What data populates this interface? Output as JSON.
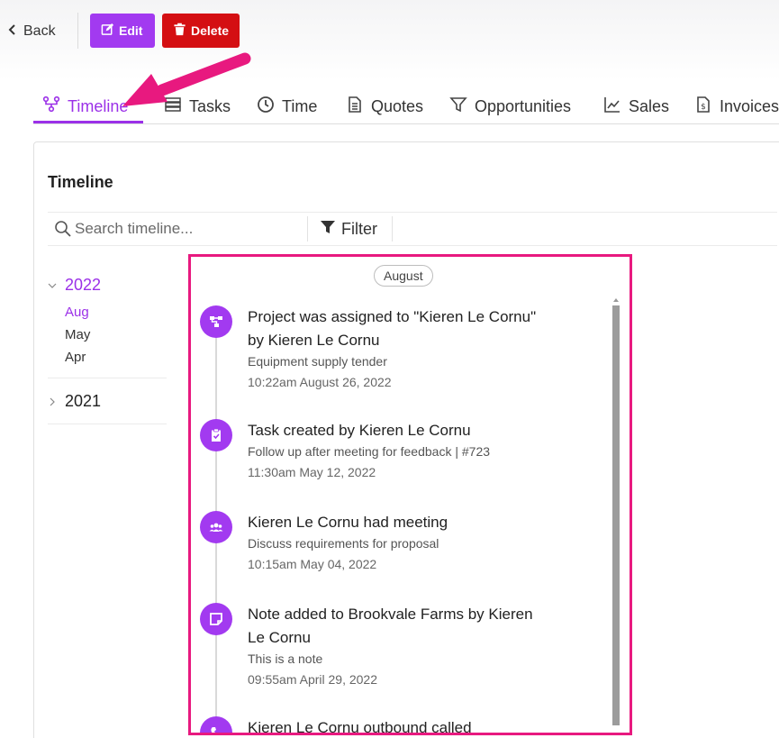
{
  "toolbar": {
    "back_label": "Back",
    "edit_label": "Edit",
    "delete_label": "Delete"
  },
  "tabs": [
    {
      "label": "Timeline",
      "icon": "timeline-icon",
      "active": true
    },
    {
      "label": "Tasks",
      "icon": "tasks-icon"
    },
    {
      "label": "Time",
      "icon": "clock-icon"
    },
    {
      "label": "Quotes",
      "icon": "document-icon"
    },
    {
      "label": "Opportunities",
      "icon": "funnel-icon"
    },
    {
      "label": "Sales",
      "icon": "line-chart-icon"
    },
    {
      "label": "Invoices",
      "icon": "invoice-icon"
    }
  ],
  "panel": {
    "title": "Timeline",
    "search_placeholder": "Search timeline...",
    "filter_label": "Filter"
  },
  "year_nav": {
    "years": [
      {
        "label": "2022",
        "expanded": true,
        "months": [
          "Aug",
          "May",
          "Apr"
        ],
        "active_month": "Aug"
      },
      {
        "label": "2021",
        "expanded": false
      }
    ]
  },
  "timeline": {
    "month_label": "August",
    "items": [
      {
        "icon": "hierarchy-icon",
        "title": "Project was assigned to \"Kieren Le Cornu\" by Kieren Le Cornu",
        "subtitle": "Equipment supply tender",
        "time": "10:22am August 26, 2022"
      },
      {
        "icon": "clipboard-check-icon",
        "title": "Task created by Kieren Le Cornu",
        "subtitle": "Follow up after meeting for feedback | #723",
        "time": "11:30am May 12, 2022"
      },
      {
        "icon": "users-icon",
        "title": "Kieren Le Cornu had meeting",
        "subtitle": "Discuss requirements for proposal",
        "time": "10:15am May 04, 2022"
      },
      {
        "icon": "sticky-note-icon",
        "title": "Note added to Brookvale Farms by Kieren Le Cornu",
        "subtitle": "This is a note",
        "time": "09:55am April 29, 2022"
      },
      {
        "icon": "phone-icon",
        "title": "Kieren Le Cornu outbound called",
        "subtitle": "",
        "time": ""
      }
    ]
  },
  "colors": {
    "accent": "#9b30e8",
    "edit_button": "#a23af0",
    "delete_button": "#d40f12",
    "highlight": "#e8197f"
  }
}
